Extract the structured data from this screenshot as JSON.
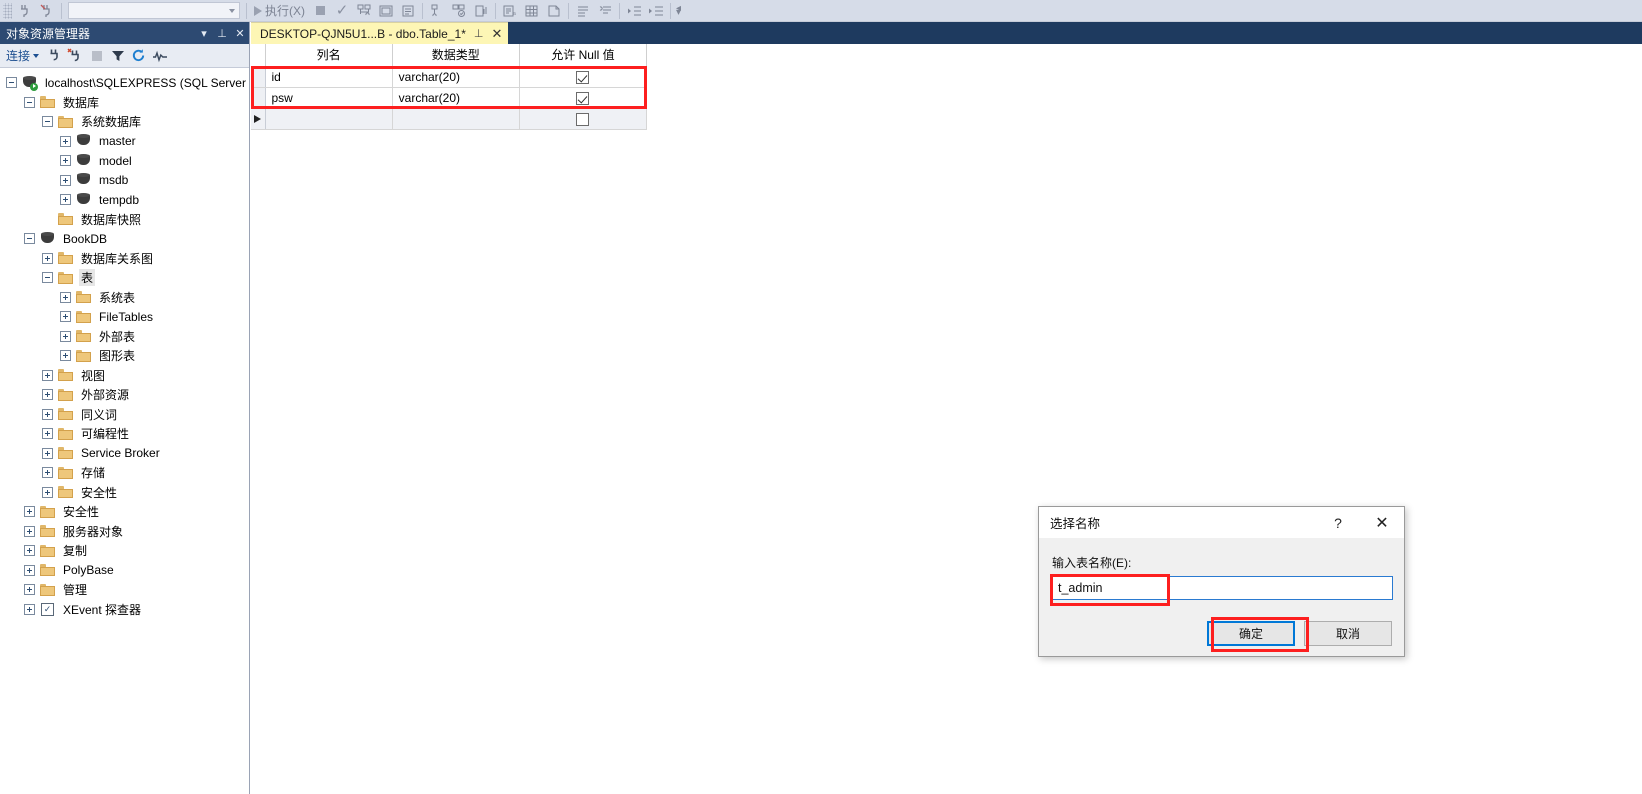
{
  "toolbar": {
    "execute_label": "执行(X)",
    "combo_value": "",
    "icons": [
      "grip",
      "connect-icon",
      "disconnect-icon",
      "sep",
      "database-combo",
      "sep",
      "play-icon",
      "stop-icon",
      "parse-check-icon",
      "display-plan-icon",
      "include-plan-icon",
      "results-grid-icon",
      "sep",
      "query-options-icon",
      "live-stats-icon",
      "stats-icon",
      "sep",
      "results-text-icon",
      "results-grid2-icon",
      "results-file-icon",
      "sep",
      "comment-icon",
      "uncomment-icon",
      "sep",
      "decrease-indent-icon",
      "increase-indent-icon",
      "sep",
      "overflow-icon"
    ]
  },
  "object_explorer": {
    "title": "对象资源管理器",
    "header_buttons": [
      "dropdown-icon",
      "pin-icon",
      "close-icon"
    ],
    "toolbar": {
      "connect_label": "连接",
      "icons": [
        "connect-icon",
        "disconnect-icon",
        "stop-icon",
        "filter-icon",
        "refresh-icon",
        "activity-icon"
      ]
    },
    "tree": [
      {
        "label": "localhost\\SQLEXPRESS (SQL Server",
        "indent": 0,
        "expander": "minus",
        "icon": "server-icon",
        "selected": false
      },
      {
        "label": "数据库",
        "indent": 1,
        "expander": "minus",
        "icon": "folder-icon",
        "selected": false
      },
      {
        "label": "系统数据库",
        "indent": 2,
        "expander": "minus",
        "icon": "folder-icon",
        "selected": false
      },
      {
        "label": "master",
        "indent": 3,
        "expander": "plus",
        "icon": "database-icon",
        "selected": false
      },
      {
        "label": "model",
        "indent": 3,
        "expander": "plus",
        "icon": "database-icon",
        "selected": false
      },
      {
        "label": "msdb",
        "indent": 3,
        "expander": "plus",
        "icon": "database-icon",
        "selected": false
      },
      {
        "label": "tempdb",
        "indent": 3,
        "expander": "plus",
        "icon": "database-icon",
        "selected": false
      },
      {
        "label": "数据库快照",
        "indent": 2,
        "expander": "none",
        "icon": "folder-icon",
        "selected": false
      },
      {
        "label": "BookDB",
        "indent": 1,
        "expander": "minus",
        "icon": "database-icon",
        "selected": false
      },
      {
        "label": "数据库关系图",
        "indent": 2,
        "expander": "plus",
        "icon": "folder-icon",
        "selected": false
      },
      {
        "label": "表",
        "indent": 2,
        "expander": "minus",
        "icon": "folder-icon",
        "selected": true
      },
      {
        "label": "系统表",
        "indent": 3,
        "expander": "plus",
        "icon": "folder-icon",
        "selected": false
      },
      {
        "label": "FileTables",
        "indent": 3,
        "expander": "plus",
        "icon": "folder-icon",
        "selected": false
      },
      {
        "label": "外部表",
        "indent": 3,
        "expander": "plus",
        "icon": "folder-icon",
        "selected": false
      },
      {
        "label": "图形表",
        "indent": 3,
        "expander": "plus",
        "icon": "folder-icon",
        "selected": false
      },
      {
        "label": "视图",
        "indent": 2,
        "expander": "plus",
        "icon": "folder-icon",
        "selected": false
      },
      {
        "label": "外部资源",
        "indent": 2,
        "expander": "plus",
        "icon": "folder-icon",
        "selected": false
      },
      {
        "label": "同义词",
        "indent": 2,
        "expander": "plus",
        "icon": "folder-icon",
        "selected": false
      },
      {
        "label": "可编程性",
        "indent": 2,
        "expander": "plus",
        "icon": "folder-icon",
        "selected": false
      },
      {
        "label": "Service Broker",
        "indent": 2,
        "expander": "plus",
        "icon": "folder-icon",
        "selected": false
      },
      {
        "label": "存储",
        "indent": 2,
        "expander": "plus",
        "icon": "folder-icon",
        "selected": false
      },
      {
        "label": "安全性",
        "indent": 2,
        "expander": "plus",
        "icon": "folder-icon",
        "selected": false
      },
      {
        "label": "安全性",
        "indent": 1,
        "expander": "plus",
        "icon": "folder-icon",
        "selected": false
      },
      {
        "label": "服务器对象",
        "indent": 1,
        "expander": "plus",
        "icon": "folder-icon",
        "selected": false
      },
      {
        "label": "复制",
        "indent": 1,
        "expander": "plus",
        "icon": "folder-icon",
        "selected": false
      },
      {
        "label": "PolyBase",
        "indent": 1,
        "expander": "plus",
        "icon": "folder-icon",
        "selected": false
      },
      {
        "label": "管理",
        "indent": 1,
        "expander": "plus",
        "icon": "folder-icon",
        "selected": false
      },
      {
        "label": "XEvent 探查器",
        "indent": 1,
        "expander": "plus",
        "icon": "xevent-icon",
        "selected": false
      }
    ]
  },
  "editor": {
    "tab": {
      "title": "DESKTOP-QJN5U1...B - dbo.Table_1*",
      "pin_icon": "pin-icon",
      "close_icon": "close-icon"
    },
    "grid": {
      "headers": [
        "",
        "列名",
        "数据类型",
        "允许 Null 值"
      ],
      "rows": [
        {
          "name": "id",
          "type": "varchar(20)",
          "allow_null": true,
          "current": false
        },
        {
          "name": "psw",
          "type": "varchar(20)",
          "allow_null": true,
          "current": false
        },
        {
          "name": "",
          "type": "",
          "allow_null": false,
          "current": true
        }
      ]
    }
  },
  "dialog": {
    "title": "选择名称",
    "help_icon": "?",
    "close_icon": "✕",
    "label": "输入表名称(E):",
    "input_value": "t_admin",
    "input_placeholder": "",
    "ok_label": "确定",
    "cancel_label": "取消"
  },
  "annotations": {
    "highlight_color": "#fd1f1f",
    "accent_color": "#0078d7",
    "tab_color": "#fdf6b5"
  }
}
